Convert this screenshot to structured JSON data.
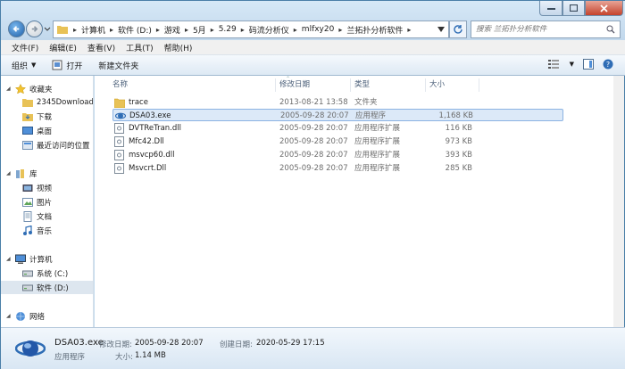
{
  "window": {
    "controls": {
      "minimize": "minimize",
      "maximize": "maximize",
      "close": "close"
    }
  },
  "breadcrumb": [
    "计算机",
    "软件 (D:)",
    "游戏",
    "5月",
    "5.29",
    "码流分析仪",
    "mlfxy20",
    "兰拓扑分析软件"
  ],
  "search": {
    "placeholder": "搜索 兰拓扑分析软件"
  },
  "menu": [
    "文件(F)",
    "编辑(E)",
    "查看(V)",
    "工具(T)",
    "帮助(H)"
  ],
  "toolbar": {
    "organize": "组织",
    "open": "打开",
    "new_folder": "新建文件夹"
  },
  "sidebar": {
    "favorites": {
      "label": "收藏夹",
      "items": [
        "2345Downloads",
        "下载",
        "桌面",
        "最近访问的位置"
      ]
    },
    "library": {
      "label": "库",
      "items": [
        "视频",
        "图片",
        "文档",
        "音乐"
      ]
    },
    "computer": {
      "label": "计算机",
      "items": [
        "系统 (C:)",
        "软件 (D:)"
      ]
    },
    "network": {
      "label": "网络"
    }
  },
  "columns": {
    "name": "名称",
    "date": "修改日期",
    "type": "类型",
    "size": "大小"
  },
  "files": [
    {
      "name": "trace",
      "date": "2013-08-21 13:58",
      "type": "文件夹",
      "size": "",
      "icon": "folder-icon"
    },
    {
      "name": "DSA03.exe",
      "date": "2005-09-28 20:07",
      "type": "应用程序",
      "size": "1,168 KB",
      "icon": "exe-icon",
      "selected": true
    },
    {
      "name": "DVTReTran.dll",
      "date": "2005-09-28 20:07",
      "type": "应用程序扩展",
      "size": "116 KB",
      "icon": "dll-icon"
    },
    {
      "name": "Mfc42.Dll",
      "date": "2005-09-28 20:07",
      "type": "应用程序扩展",
      "size": "973 KB",
      "icon": "dll-icon"
    },
    {
      "name": "msvcp60.dll",
      "date": "2005-09-28 20:07",
      "type": "应用程序扩展",
      "size": "393 KB",
      "icon": "dll-icon"
    },
    {
      "name": "Msvcrt.Dll",
      "date": "2005-09-28 20:07",
      "type": "应用程序扩展",
      "size": "285 KB",
      "icon": "dll-icon"
    }
  ],
  "details": {
    "name": "DSA03.exe",
    "type": "应用程序",
    "modified_label": "修改日期:",
    "modified": "2005-09-28 20:07",
    "created_label": "创建日期:",
    "created": "2020-05-29 17:15",
    "size_label": "大小:",
    "size": "1.14 MB"
  }
}
